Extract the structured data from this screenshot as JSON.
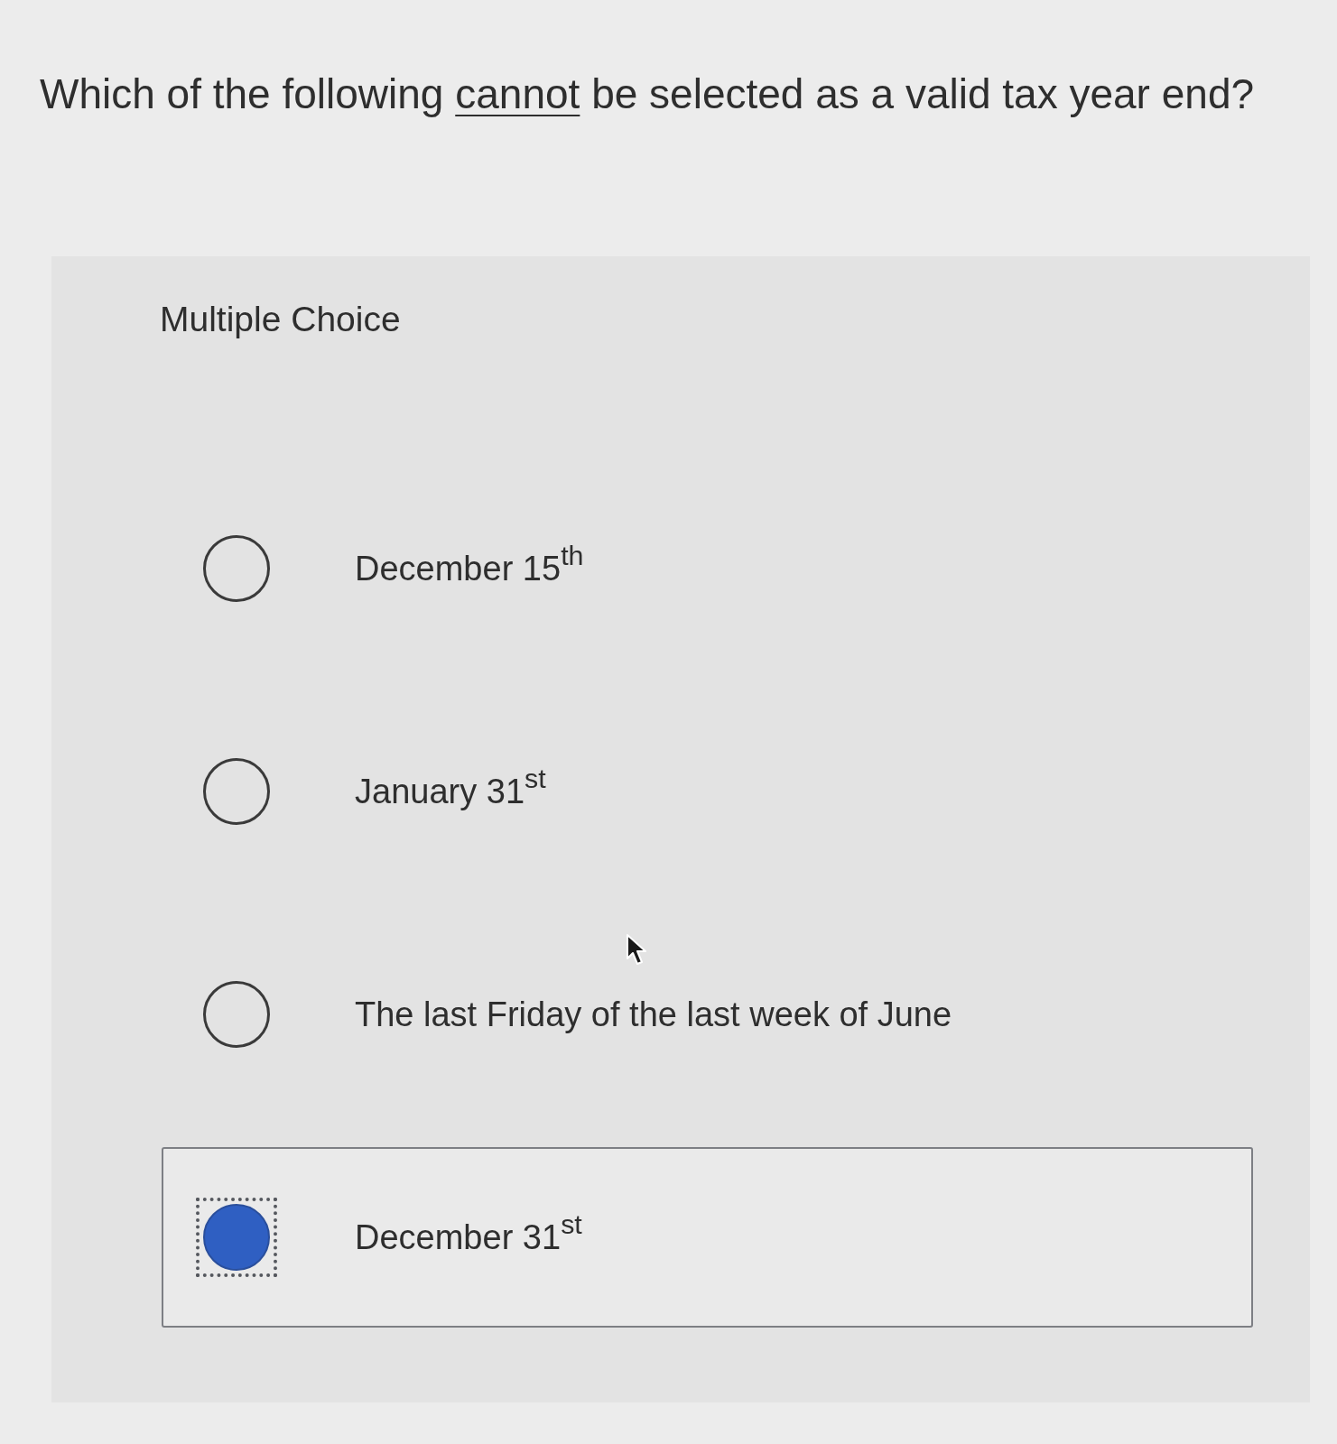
{
  "question": {
    "parts": [
      {
        "text": "Which of the following ",
        "underlined": false
      },
      {
        "text": "cannot",
        "underlined": true
      },
      {
        "text": " be selected as a valid tax year end?",
        "underlined": false
      }
    ]
  },
  "answer_panel": {
    "label": "Multiple Choice",
    "options": [
      {
        "text": "December 15$^{th}$",
        "selected": false
      },
      {
        "text": "January 31$^{st}$",
        "selected": false
      },
      {
        "text": "The last Friday of the last week of June",
        "selected": false
      },
      {
        "text": "December 31$^{st}$",
        "selected": true
      }
    ]
  }
}
